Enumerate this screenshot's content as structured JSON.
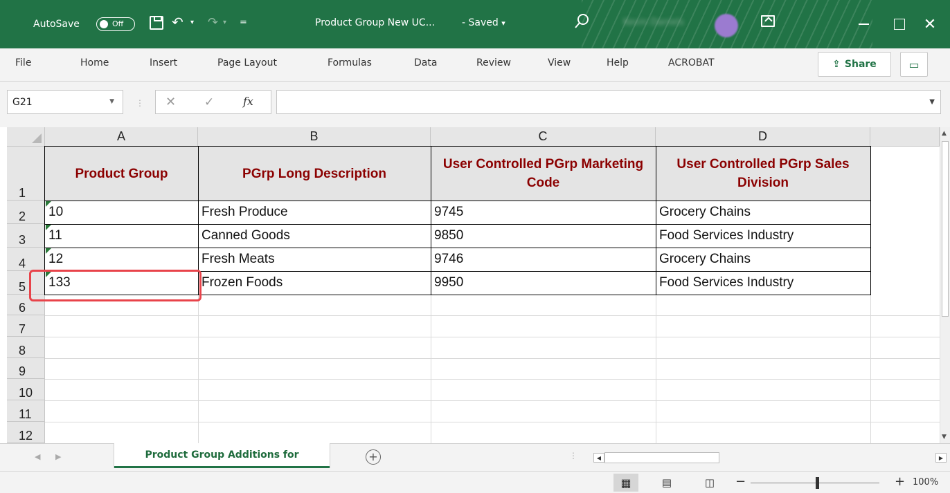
{
  "titlebar": {
    "autosave_label": "AutoSave",
    "autosave_state": "Off",
    "doc_title": "Product Group New UC...",
    "saved_status": "- Saved",
    "saved_caret": "▾",
    "user_name": "Kevin Daniels",
    "close_glyph": "✕"
  },
  "ribbon": {
    "tabs": [
      "File",
      "Home",
      "Insert",
      "Page Layout",
      "Formulas",
      "Data",
      "Review",
      "View",
      "Help",
      "ACROBAT"
    ],
    "share_label": "Share",
    "share_icon": "share-icon",
    "comments_icon": "comments-icon"
  },
  "formula_bar": {
    "name_box": "G21",
    "fx_label": "fx",
    "formula": ""
  },
  "grid": {
    "columns": [
      "A",
      "B",
      "C",
      "D"
    ],
    "rows": [
      "1",
      "2",
      "3",
      "4",
      "5",
      "6",
      "7",
      "8",
      "9",
      "10",
      "11",
      "12"
    ],
    "header_row": {
      "a": "Product Group",
      "b": "PGrp Long Description",
      "c": "User Controlled PGrp Marketing Code",
      "d": "User Controlled PGrp Sales Division"
    },
    "data_rows": [
      {
        "a": "10",
        "b": "Fresh Produce",
        "c": "9745",
        "d": "Grocery Chains"
      },
      {
        "a": "11",
        "b": "Canned Goods",
        "c": "9850",
        "d": "Food Services Industry"
      },
      {
        "a": "12",
        "b": "Fresh Meats",
        "c": "9746",
        "d": "Grocery Chains"
      },
      {
        "a": "133",
        "b": "Frozen Foods",
        "c": "9950",
        "d": "Food Services Industry"
      }
    ],
    "header_color": "#8b0000",
    "highlight_color": "#e8434a"
  },
  "sheets": {
    "active": "Product Group Additions for"
  },
  "status": {
    "zoom": "100%",
    "zoom_fraction": 0.5
  },
  "colors": {
    "brand": "#217346"
  }
}
